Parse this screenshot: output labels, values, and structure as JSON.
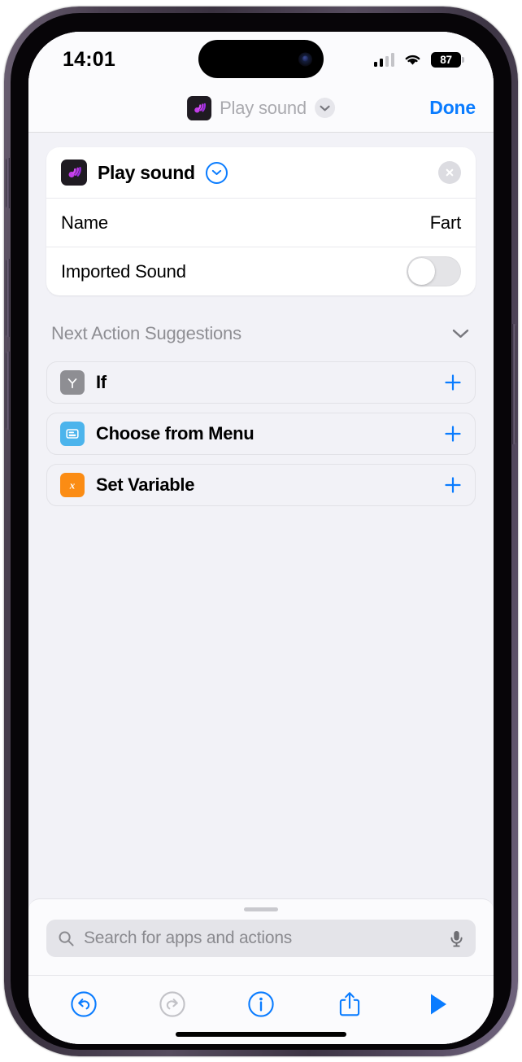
{
  "status_bar": {
    "time": "14:01",
    "signal_icon": "cellular-signal-icon",
    "signal_bars_filled": 2,
    "signal_bars_total": 4,
    "wifi_icon": "wifi-icon",
    "battery_level": "87",
    "battery_icon": "battery-icon"
  },
  "nav_header": {
    "app_icon": "play-sound-app-icon",
    "title": "Play sound",
    "chevron_icon": "chevron-down-icon",
    "done_label": "Done"
  },
  "action_card": {
    "icon": "play-sound-app-icon",
    "title": "Play sound",
    "expand_icon": "chevron-down-circle-icon",
    "close_icon": "close-circle-icon",
    "rows": [
      {
        "label": "Name",
        "value": "Fart",
        "type": "value"
      },
      {
        "label": "Imported Sound",
        "value": "off",
        "type": "toggle"
      }
    ]
  },
  "suggestions": {
    "title": "Next Action Suggestions",
    "collapse_icon": "chevron-down-icon",
    "items": [
      {
        "label": "If",
        "icon": "branch-icon",
        "color": "#8e8e93",
        "add_icon": "plus-icon"
      },
      {
        "label": "Choose from Menu",
        "icon": "menu-list-icon",
        "color": "#4cb4ec",
        "add_icon": "plus-icon"
      },
      {
        "label": "Set Variable",
        "icon": "variable-x-icon",
        "color": "#fb8c14",
        "add_icon": "plus-icon"
      }
    ]
  },
  "bottom_panel": {
    "grabber": "drag-handle",
    "search_placeholder": "Search for apps and actions",
    "search_icon": "search-icon",
    "mic_icon": "microphone-icon",
    "toolbar": [
      {
        "name": "undo",
        "icon": "undo-icon",
        "enabled": true
      },
      {
        "name": "redo",
        "icon": "redo-icon",
        "enabled": false
      },
      {
        "name": "info",
        "icon": "info-icon",
        "enabled": true
      },
      {
        "name": "share",
        "icon": "share-icon",
        "enabled": true
      },
      {
        "name": "play",
        "icon": "play-icon",
        "enabled": true
      }
    ]
  },
  "colors": {
    "accent_blue": "#0a7cff",
    "disabled_gray": "#c2c2c7",
    "screen_background": "#f2f2f7",
    "card_background": "#ffffff"
  }
}
